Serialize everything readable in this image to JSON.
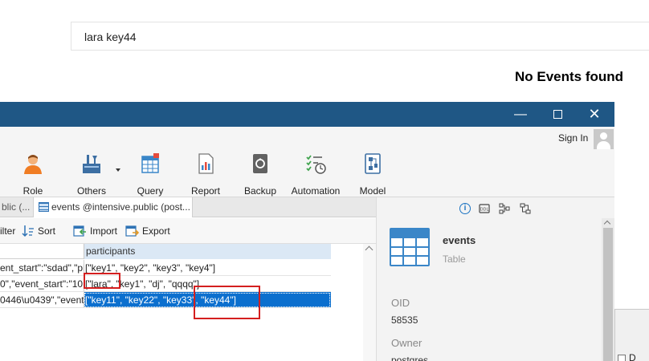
{
  "web": {
    "search_value": "lara key44",
    "empty_message": "No Events found"
  },
  "app": {
    "window_controls": {
      "minimize": "—",
      "close": "✕"
    },
    "sign_in": "Sign In",
    "ribbon": [
      {
        "label": "Role",
        "icon": "role-user-icon"
      },
      {
        "label": "Others",
        "icon": "others-tools-icon"
      },
      {
        "label": "Query",
        "icon": "query-table-icon"
      },
      {
        "label": "Report",
        "icon": "report-icon"
      },
      {
        "label": "Backup",
        "icon": "backup-icon"
      },
      {
        "label": "Automation",
        "icon": "automation-icon"
      },
      {
        "label": "Model",
        "icon": "model-icon"
      }
    ],
    "tabs": [
      {
        "label": "blic (..."
      },
      {
        "label": "events @intensive.public (post..."
      }
    ],
    "toolbar": {
      "filter": "ilter",
      "sort": "Sort",
      "import": "Import",
      "export": "Export"
    },
    "grid": {
      "column_header": "participants",
      "rows": [
        {
          "c1": "ent_start\":\"sdad\",\"pl",
          "c2": "[\"key1\", \"key2\", \"key3\", \"key4\"]"
        },
        {
          "c1": "0\",\"event_start\":\"10",
          "c2": "[\"lara\", \"key1\", \"dj\", \"qqqq\"]"
        },
        {
          "c1": "0446\\u0439\",\"event",
          "c2": "[\"key11\", \"key22\", \"key33\", \"key44\"]"
        }
      ]
    },
    "panel": {
      "object_name": "events",
      "object_type": "Table",
      "oid_label": "OID",
      "oid_value": "58535",
      "owner_label": "Owner",
      "owner_value": "postgres"
    },
    "dialog_fragment": "D",
    "colors": {
      "titlebar": "#1f5785",
      "selection": "#0b6fce",
      "highlight": "#d41f1f",
      "accent": "#3a86c8"
    }
  }
}
